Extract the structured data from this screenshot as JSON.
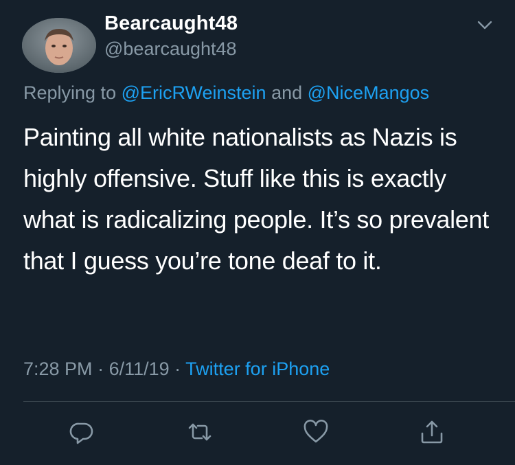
{
  "author": {
    "display_name": "Bearcaught48",
    "handle": "@bearcaught48",
    "avatar": "user-avatar-photo"
  },
  "reply": {
    "prefix": "Replying to ",
    "mention_1": "@EricRWeinstein",
    "joiner": " and ",
    "mention_2": "@NiceMangos"
  },
  "tweet": {
    "text": "Painting all white nationalists as Nazis is highly offensive. Stuff like this is exactly what is radicalizing people. It’s so prevalent that I guess you’re tone deaf to it."
  },
  "meta": {
    "time": "7:28 PM",
    "sep_1": " · ",
    "date": "6/11/19",
    "sep_2": " · ",
    "source": "Twitter for iPhone"
  },
  "actions": {
    "reply": "reply-icon",
    "retweet": "retweet-icon",
    "like": "heart-icon",
    "share": "share-icon",
    "menu": "chevron-down-icon"
  },
  "colors": {
    "background": "#15202b",
    "secondary_text": "#8899a6",
    "accent": "#1da1f2",
    "divider": "#38444d"
  }
}
